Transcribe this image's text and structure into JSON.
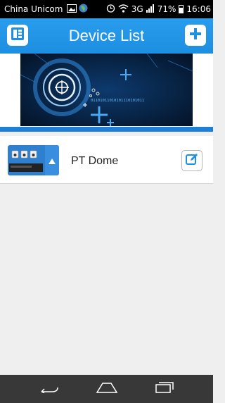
{
  "status_bar": {
    "carrier": "China Unicom",
    "network": "3G",
    "battery": "71%",
    "time": "16:06",
    "icons": [
      "image-icon",
      "globe-icon",
      "alarm-icon",
      "wifi-icon",
      "signal-icon",
      "battery-icon"
    ]
  },
  "header": {
    "title": "Device List",
    "left_icon": "menu-list-icon",
    "right_icon": "plus-icon"
  },
  "banner": {
    "binary_text": "01101011010101110101011"
  },
  "devices": [
    {
      "name": "PT Dome",
      "thumb_icon": "camera-dvr-icon",
      "edit_icon": "edit-icon"
    }
  ],
  "navigation": {
    "icons": [
      "back-icon",
      "home-icon",
      "recent-apps-icon"
    ]
  },
  "colors": {
    "accent": "#2196e6",
    "header_dark": "#1d7fd6",
    "navbar": "#383838",
    "background": "#efefef"
  }
}
